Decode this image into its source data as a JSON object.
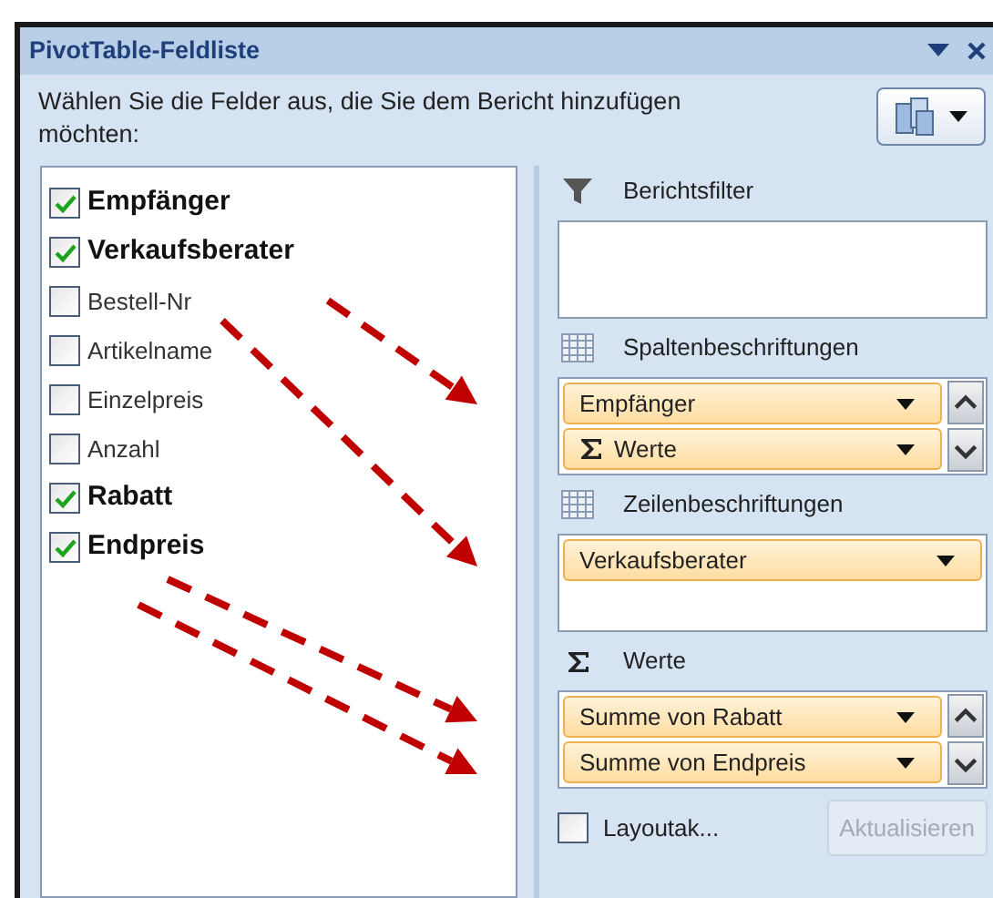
{
  "window": {
    "title": "PivotTable-Feldliste"
  },
  "instruction": "Wählen Sie die Felder aus, die Sie dem Bericht hinzufügen möchten:",
  "fields": [
    {
      "label": "Empfänger",
      "checked": true
    },
    {
      "label": "Verkaufsberater",
      "checked": true
    },
    {
      "label": "Bestell-Nr",
      "checked": false
    },
    {
      "label": "Artikelname",
      "checked": false
    },
    {
      "label": "Einzelpreis",
      "checked": false
    },
    {
      "label": "Anzahl",
      "checked": false
    },
    {
      "label": "Rabatt",
      "checked": true
    },
    {
      "label": "Endpreis",
      "checked": true
    }
  ],
  "areas": [
    {
      "kind": "filter",
      "title": "Berichtsfilter"
    },
    {
      "kind": "columns",
      "title": "Spaltenbeschriftungen",
      "items": [
        {
          "label": "Empfänger",
          "kind": "field"
        },
        {
          "label": "Werte",
          "kind": "sigma"
        }
      ]
    },
    {
      "kind": "rows",
      "title": "Zeilenbeschriftungen",
      "items": [
        {
          "label": "Verkaufsberater",
          "kind": "field"
        }
      ]
    },
    {
      "kind": "values",
      "title": "Werte",
      "items": [
        {
          "label": "Summe von Rabatt",
          "kind": "field"
        },
        {
          "label": "Summe von Endpreis",
          "kind": "field"
        }
      ]
    }
  ],
  "defer_layout": {
    "label": "Layoutak...",
    "checked": false
  },
  "update_button": {
    "label": "Aktualisieren",
    "disabled": true
  }
}
